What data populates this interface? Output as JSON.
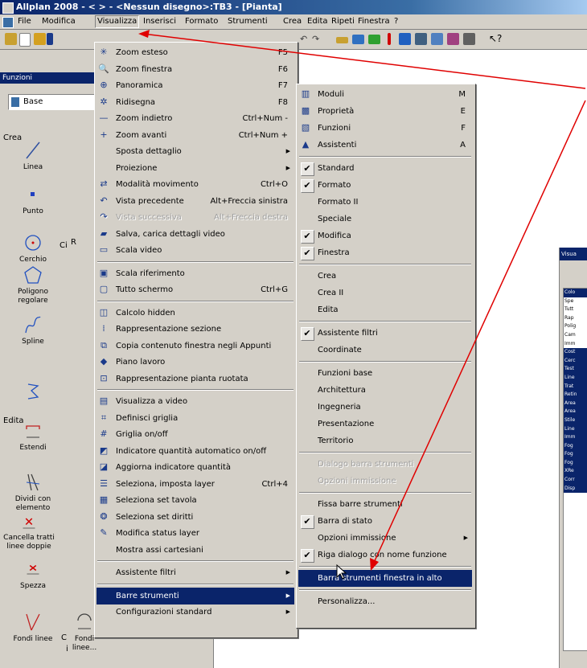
{
  "window": {
    "title": "Allplan 2008 - <   > - <Nessun disegno>:TB3 - [Pianta]"
  },
  "menubar": {
    "items": [
      "File",
      "Modifica",
      "Visualizza",
      "Inserisci",
      "Formato",
      "Strumenti",
      "Crea",
      "Edita",
      "Ripeti",
      "Finestra",
      "?"
    ]
  },
  "panel": {
    "title": "Funzioni",
    "combo_value": "Base",
    "section_crea": "Crea",
    "section_edita": "Edita",
    "tools": [
      "Linea",
      "Punto",
      "Cerchio",
      "Poligono regolare",
      "Spline",
      "Estendi",
      "Dividi con elemento",
      "Cancella tratti linee doppie",
      "Spezza",
      "Fondi linee",
      "Fondi linee..."
    ],
    "partial": [
      "R",
      "Ci",
      "C",
      "i"
    ]
  },
  "visualizza_menu": [
    {
      "label": "Zoom esteso",
      "shortcut": "F5",
      "icon": "zoom-extents-icon",
      "glyph": "✳"
    },
    {
      "label": "Zoom finestra",
      "shortcut": "F6",
      "icon": "zoom-window-icon",
      "glyph": "🔍"
    },
    {
      "label": "Panoramica",
      "shortcut": "F7",
      "icon": "pan-icon",
      "glyph": "⊕"
    },
    {
      "label": "Ridisegna",
      "shortcut": "F8",
      "icon": "redraw-icon",
      "glyph": "✲"
    },
    {
      "label": "Zoom indietro",
      "shortcut": "Ctrl+Num -",
      "icon": "zoom-out-icon",
      "glyph": "—"
    },
    {
      "label": "Zoom avanti",
      "shortcut": "Ctrl+Num +",
      "icon": "zoom-in-icon",
      "glyph": "+"
    },
    {
      "label": "Sposta dettaglio",
      "shortcut": "",
      "submenu": true
    },
    {
      "label": "Proiezione",
      "shortcut": "",
      "submenu": true
    },
    {
      "label": "Modalità movimento",
      "shortcut": "Ctrl+O",
      "icon": "move-mode-icon",
      "glyph": "⇄"
    },
    {
      "label": "Vista precedente",
      "shortcut": "Alt+Freccia sinistra",
      "icon": "previous-view-icon",
      "glyph": "↶"
    },
    {
      "label": "Vista successiva",
      "shortcut": "Alt+Freccia destra",
      "icon": "next-view-icon",
      "glyph": "↷",
      "disabled": true
    },
    {
      "label": "Salva, carica dettagli video",
      "shortcut": "",
      "icon": "save-view-icon",
      "glyph": "▰"
    },
    {
      "label": "Scala video",
      "shortcut": "",
      "icon": "screen-scale-icon",
      "glyph": "▭"
    },
    {
      "sep": true
    },
    {
      "label": "Scala riferimento",
      "shortcut": "",
      "icon": "reference-scale-icon",
      "glyph": "▣"
    },
    {
      "label": "Tutto schermo",
      "shortcut": "Ctrl+G",
      "icon": "fullscreen-icon",
      "glyph": "▢"
    },
    {
      "sep": true
    },
    {
      "label": "Calcolo hidden",
      "shortcut": "",
      "icon": "hidden-calc-icon",
      "glyph": "◫"
    },
    {
      "label": "Rappresentazione sezione",
      "shortcut": "",
      "icon": "section-view-icon",
      "glyph": "⁞"
    },
    {
      "label": "Copia contenuto finestra negli Appunti",
      "shortcut": "",
      "icon": "copy-clipboard-icon",
      "glyph": "⧉"
    },
    {
      "label": "Piano lavoro",
      "shortcut": "",
      "icon": "work-plane-icon",
      "glyph": "◆"
    },
    {
      "label": "Rappresentazione pianta ruotata",
      "shortcut": "",
      "icon": "rotated-plan-icon",
      "glyph": "⊡"
    },
    {
      "sep": true
    },
    {
      "label": "Visualizza a video",
      "shortcut": "",
      "icon": "display-icon",
      "glyph": "▤"
    },
    {
      "label": "Definisci griglia",
      "shortcut": "",
      "icon": "define-grid-icon",
      "glyph": "⌗"
    },
    {
      "label": "Griglia on/off",
      "shortcut": "",
      "icon": "grid-toggle-icon",
      "glyph": "#"
    },
    {
      "label": "Indicatore quantità automatico on/off",
      "shortcut": "",
      "icon": "auto-quantity-icon",
      "glyph": "◩"
    },
    {
      "label": "Aggiorna indicatore quantità",
      "shortcut": "",
      "icon": "update-quantity-icon",
      "glyph": "◪"
    },
    {
      "label": "Seleziona, imposta layer",
      "shortcut": "Ctrl+4",
      "icon": "layer-select-icon",
      "glyph": "☰"
    },
    {
      "label": "Seleziona set tavola",
      "shortcut": "",
      "icon": "sheet-set-icon",
      "glyph": "▦"
    },
    {
      "label": "Seleziona set diritti",
      "shortcut": "",
      "icon": "rights-set-icon",
      "glyph": "❂"
    },
    {
      "label": "Modifica status layer",
      "shortcut": "",
      "icon": "layer-status-icon",
      "glyph": "✎"
    },
    {
      "label": "Mostra assi cartesiani",
      "shortcut": ""
    },
    {
      "sep": true
    },
    {
      "label": "Assistente filtri",
      "shortcut": "",
      "submenu": true
    },
    {
      "sep": true
    },
    {
      "label": "Barre strumenti",
      "shortcut": "",
      "submenu": true,
      "highlight": true
    },
    {
      "label": "Configurazioni standard",
      "shortcut": "",
      "submenu": true
    }
  ],
  "toolbars_menu": [
    {
      "label": "Moduli",
      "shortcut": "M",
      "icon": "modules-icon",
      "glyph": "▥"
    },
    {
      "label": "Proprietà",
      "shortcut": "E",
      "icon": "properties-icon",
      "glyph": "▩"
    },
    {
      "label": "Funzioni",
      "shortcut": "F",
      "icon": "functions-icon",
      "glyph": "▧"
    },
    {
      "label": "Assistenti",
      "shortcut": "A",
      "icon": "assistants-icon",
      "glyph": "▲"
    },
    {
      "sep": true
    },
    {
      "label": "Standard",
      "checked": true
    },
    {
      "label": "Formato",
      "checked": true
    },
    {
      "label": "Formato II"
    },
    {
      "label": "Speciale"
    },
    {
      "label": "Modifica",
      "checked": true
    },
    {
      "label": "Finestra",
      "checked": true
    },
    {
      "sep": true
    },
    {
      "label": "Crea"
    },
    {
      "label": "Crea II"
    },
    {
      "label": "Edita"
    },
    {
      "sep": true
    },
    {
      "label": "Assistente filtri",
      "checked": true
    },
    {
      "label": "Coordinate"
    },
    {
      "sep": true
    },
    {
      "label": "Funzioni base"
    },
    {
      "label": "Architettura"
    },
    {
      "label": "Ingegneria"
    },
    {
      "label": "Presentazione"
    },
    {
      "label": "Territorio"
    },
    {
      "sep": true
    },
    {
      "label": "Dialogo barra strumenti",
      "disabled": true
    },
    {
      "label": "Opzioni immissione",
      "disabled": true
    },
    {
      "sep": true
    },
    {
      "label": "Fissa barre strumenti"
    },
    {
      "label": "Barra di stato",
      "checked": true
    },
    {
      "label": "Opzioni immissione",
      "submenu": true
    },
    {
      "label": "Riga dialogo con nome funzione",
      "checked": true
    },
    {
      "sep": true
    },
    {
      "label": "Barra strumenti finestra in alto",
      "highlight": true
    },
    {
      "sep": true
    },
    {
      "label": "Personalizza..."
    }
  ],
  "right_dialog": {
    "title": "Visua",
    "rows": [
      "Colo",
      "Spe",
      "Tutt",
      "Rap",
      "Polig",
      "Cam",
      "Imm",
      "Cost",
      "Cerc",
      "Test",
      "Line",
      "Trat",
      "Retin",
      "Area",
      "Area",
      "Stile",
      "Line",
      "Imm",
      "Fog",
      "Fog",
      "Fog",
      "XRe",
      "Corr",
      "Disp"
    ]
  },
  "colors": {
    "highlight": "#0a246a",
    "menu_bg": "#d4d0c8",
    "arrow": "#e00000",
    "title_start": "#0a246a",
    "title_end": "#a6caf0"
  }
}
